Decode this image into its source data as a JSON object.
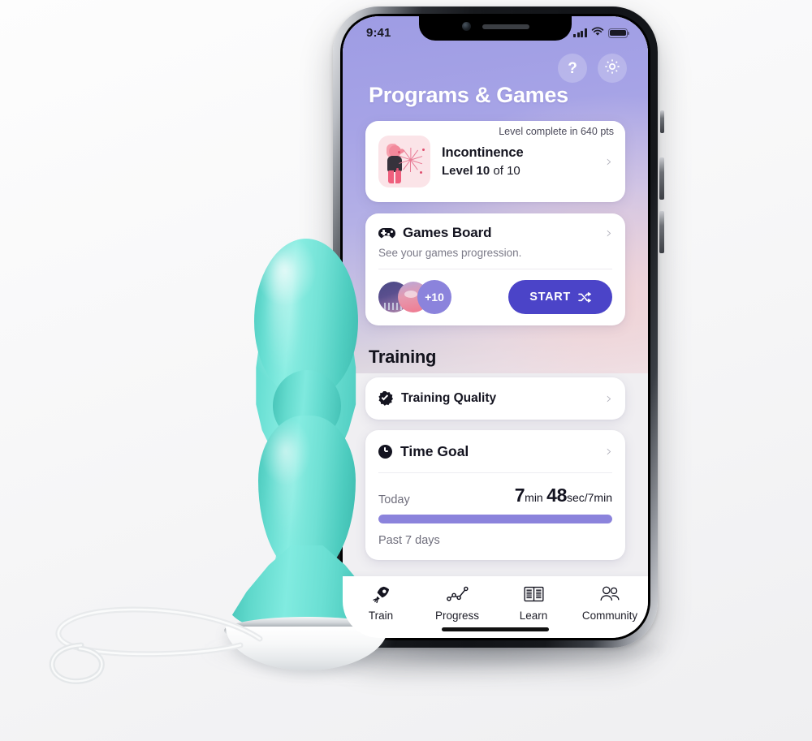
{
  "device": {
    "name": "pelvic-floor-trainer",
    "body_color": "#6DE0D4",
    "chrome_color": "#C9CED3",
    "base_color": "#FFFFFF",
    "cable_color": "#E4E7E9"
  },
  "phone": {
    "status_bar": {
      "time": "9:41",
      "signal_icon": "cellular-bars-icon",
      "wifi_icon": "wifi-icon",
      "battery_icon": "battery-full-icon"
    },
    "home_indicator": true
  },
  "app": {
    "theme": {
      "header_gradient_start": "#9E9CE4",
      "header_gradient_end": "#F7D6D6",
      "background": "#F0EFF2",
      "accent": "#4B44C8",
      "progress": "#8B83DC",
      "card": "#FFFFFF"
    },
    "header": {
      "title": "Programs & Games",
      "help_label": "?",
      "help_icon": "question-mark-icon",
      "settings_icon": "gear-icon"
    },
    "program_card": {
      "banner": "Level complete in 640 pts",
      "thumb_icon": "celebration-fireworks-illustration",
      "title": "Incontinence",
      "level_prefix": "Level",
      "level_value": "10",
      "level_suffix": "of 10",
      "chevron_icon": "chevron-right-icon"
    },
    "games_card": {
      "icon": "gamepad-icon",
      "title": "Games Board",
      "description": "See your games progression.",
      "chevron_icon": "chevron-right-icon",
      "avatar_overflow": "+10",
      "start_label": "START",
      "start_icon": "shuffle-icon"
    },
    "training": {
      "section_title": "Training",
      "quality_row": {
        "icon": "verified-badge-icon",
        "label": "Training Quality",
        "chevron_icon": "chevron-right-icon"
      },
      "time_goal": {
        "icon": "clock-icon",
        "label": "Time Goal",
        "chevron_icon": "chevron-right-icon",
        "today_label": "Today",
        "today_minutes": "7",
        "today_min_unit": "min",
        "today_seconds": "48",
        "today_sec_unit": "sec/7min",
        "progress_percent": 100,
        "past_label": "Past 7 days"
      }
    },
    "tabs": [
      {
        "label": "Train",
        "icon": "rocket-icon",
        "active": true
      },
      {
        "label": "Progress",
        "icon": "line-chart-icon",
        "active": false
      },
      {
        "label": "Learn",
        "icon": "open-book-icon",
        "active": false
      },
      {
        "label": "Community",
        "icon": "people-group-icon",
        "active": false
      }
    ]
  }
}
